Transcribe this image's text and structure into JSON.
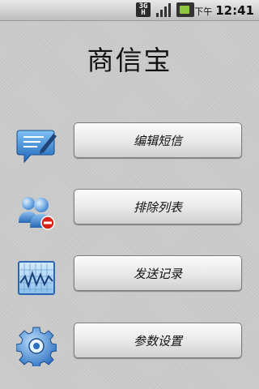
{
  "status_bar": {
    "network_type": "3G",
    "network_sub": "H",
    "ampm": "下午",
    "time": "12:41",
    "icons": [
      "network-3g-icon",
      "signal-strength-icon",
      "battery-icon"
    ]
  },
  "app": {
    "title": "商信宝"
  },
  "menu": {
    "items": [
      {
        "label": "编辑短信",
        "icon": "edit-message-icon"
      },
      {
        "label": "排除列表",
        "icon": "exclude-users-icon"
      },
      {
        "label": "发送记录",
        "icon": "send-log-chart-icon"
      },
      {
        "label": "参数设置",
        "icon": "gear-icon"
      }
    ]
  },
  "colors": {
    "background": "#cfcfcf",
    "button_top": "#fbfbfb",
    "button_bottom": "#cfcfcf",
    "icon_blue": "#2f7fd0"
  }
}
